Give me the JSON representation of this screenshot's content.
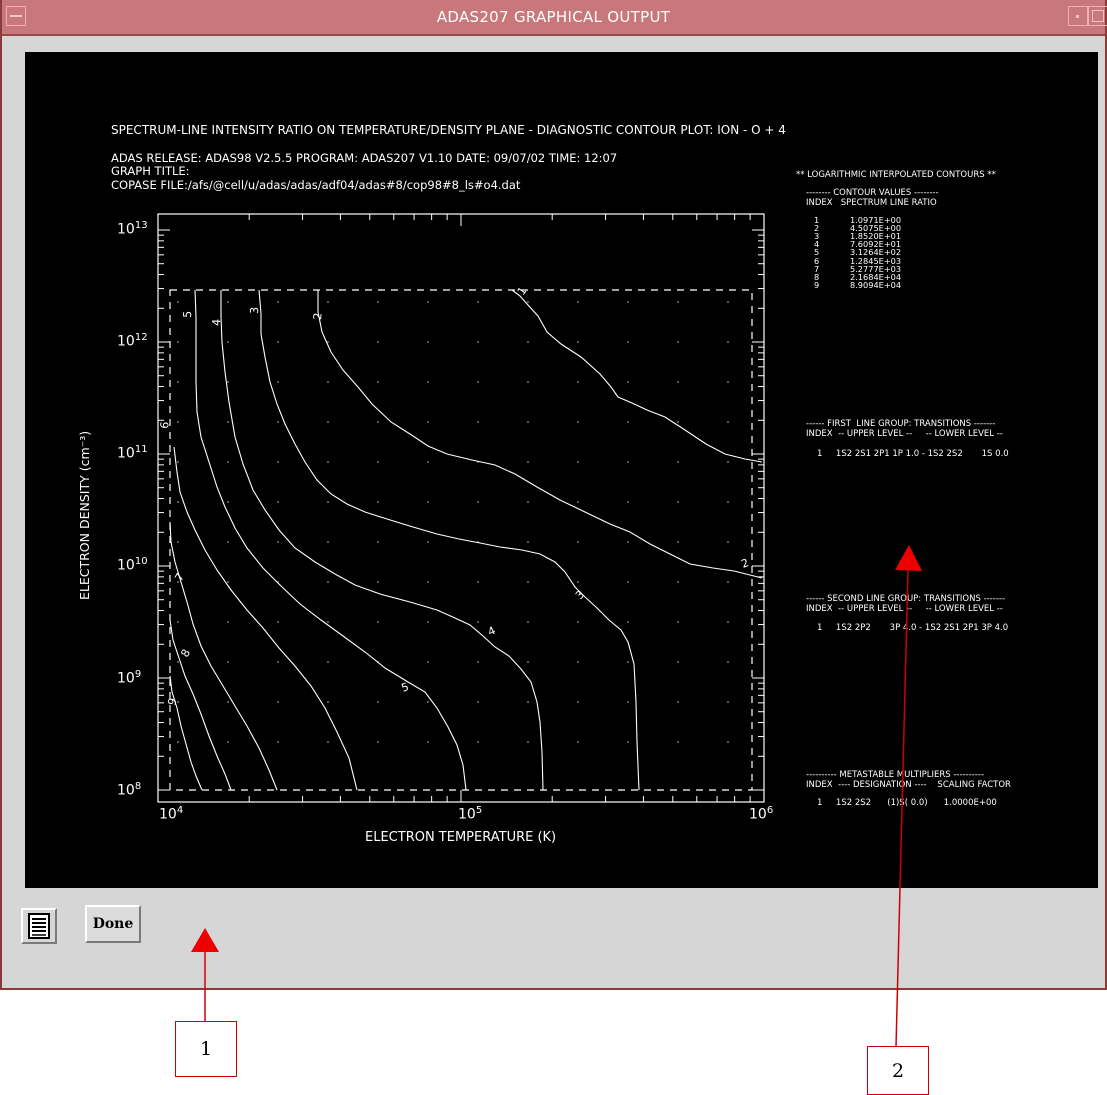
{
  "window": {
    "title": "ADAS207 GRAPHICAL OUTPUT"
  },
  "plot": {
    "header": {
      "line1": "SPECTRUM-LINE INTENSITY RATIO ON TEMPERATURE/DENSITY PLANE - DIAGNOSTIC CONTOUR PLOT: ION - O + 4",
      "line2": "ADAS RELEASE: ADAS98 V2.5.5 PROGRAM: ADAS207 V1.10 DATE: 09/07/02 TIME: 12:07",
      "line3": "GRAPH TITLE:",
      "line4": "COPASE FILE:/afs/@cell/u/adas/adas/adf04/adas#8/cop98#8_ls#o4.dat"
    },
    "xlabel": "ELECTRON TEMPERATURE (K)",
    "ylabel": "ELECTRON DENSITY (cm⁻³)",
    "x_ticks": [
      {
        "base": "10",
        "exp": "4"
      },
      {
        "base": "10",
        "exp": "5"
      },
      {
        "base": "10",
        "exp": "6"
      }
    ],
    "y_ticks": [
      {
        "base": "10",
        "exp": "8"
      },
      {
        "base": "10",
        "exp": "9"
      },
      {
        "base": "10",
        "exp": "10"
      },
      {
        "base": "10",
        "exp": "11"
      },
      {
        "base": "10",
        "exp": "12"
      },
      {
        "base": "10",
        "exp": "13"
      }
    ],
    "contour_labels": [
      "1",
      "2",
      "3",
      "4",
      "5",
      "6",
      "7",
      "8",
      "9"
    ]
  },
  "side": {
    "log_title": "** LOGARITHMIC INTERPOLATED CONTOURS **",
    "contour_header": "-------- CONTOUR VALUES --------",
    "contour_cols": "INDEX   SPECTRUM LINE RATIO",
    "contours": [
      {
        "index": "1",
        "value": "1.0971E+00"
      },
      {
        "index": "2",
        "value": "4.5075E+00"
      },
      {
        "index": "3",
        "value": "1.8520E+01"
      },
      {
        "index": "4",
        "value": "7.6092E+01"
      },
      {
        "index": "5",
        "value": "3.1264E+02"
      },
      {
        "index": "6",
        "value": "1.2845E+03"
      },
      {
        "index": "7",
        "value": "5.2777E+03"
      },
      {
        "index": "8",
        "value": "2.1684E+04"
      },
      {
        "index": "9",
        "value": "8.9094E+04"
      }
    ],
    "first_header": "------ FIRST  LINE GROUP: TRANSITIONS -------",
    "first_cols": "INDEX  -- UPPER LEVEL --     -- LOWER LEVEL --",
    "first_row": "1     1S2 2S1 2P1 1P 1.0 - 1S2 2S2       1S 0.0",
    "second_header": "------ SECOND LINE GROUP: TRANSITIONS -------",
    "second_cols": "INDEX  -- UPPER LEVEL --     -- LOWER LEVEL --",
    "second_row": "1     1S2 2P2       3P 4.0 - 1S2 2S1 2P1 3P 4.0",
    "meta_header": "---------- METASTABLE MULTIPLIERS ----------",
    "meta_cols": "INDEX  ---- DESIGNATION ----    SCALING FACTOR",
    "meta_row": "1     1S2 2S2      (1)S( 0.0)      1.0000E+00"
  },
  "controls": {
    "done_label": "Done"
  },
  "callouts": [
    {
      "label": "1"
    },
    {
      "label": "2"
    }
  ]
}
